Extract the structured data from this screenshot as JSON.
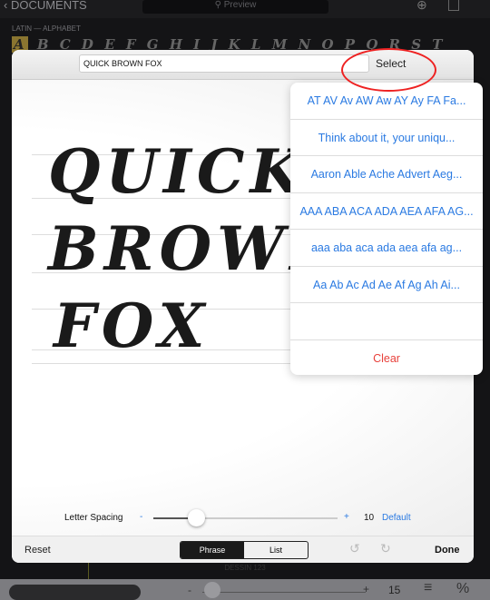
{
  "topbar": {
    "back_label": "DOCUMENTS",
    "search_placeholder": "Preview"
  },
  "section_label": "LATIN — ALPHABET",
  "alphabet_first": "A",
  "alphabet_rest": "B C D E F G H I J K L M N O P Q R S T",
  "modal": {
    "phrase_value": "QUICK BROWN FOX",
    "select_label": "Select",
    "preview_lines": [
      "QUICK",
      "BROWN",
      "FOX"
    ],
    "letter_spacing": {
      "label": "Letter Spacing",
      "minus": "-",
      "plus": "+",
      "value": "10",
      "value_fraction": 0.23,
      "default_label": "Default"
    },
    "footer": {
      "reset": "Reset",
      "segments": [
        "Phrase",
        "List"
      ],
      "selected_segment": "Phrase",
      "done": "Done"
    }
  },
  "popover": {
    "items": [
      "AT AV Av AW Aw AY Ay FA Fa...",
      "Think about it, your uniqu...",
      "Aaron Able Ache Advert Aeg...",
      "AAA ABA ACA ADA AEA AFA AG...",
      "aaa aba aca ada aea afa ag...",
      "Aa Ab Ac Ad Ae Af Ag Ah Ai..."
    ],
    "clear": "Clear"
  },
  "background_label": "DESSIN 123",
  "bottom": {
    "minus": "-",
    "plus": "+",
    "value": "15",
    "menu_icon": "≡",
    "percent": "%"
  },
  "colors": {
    "accent": "#2a7ae2",
    "destructive": "#e8413b",
    "annotation": "#e22222"
  }
}
